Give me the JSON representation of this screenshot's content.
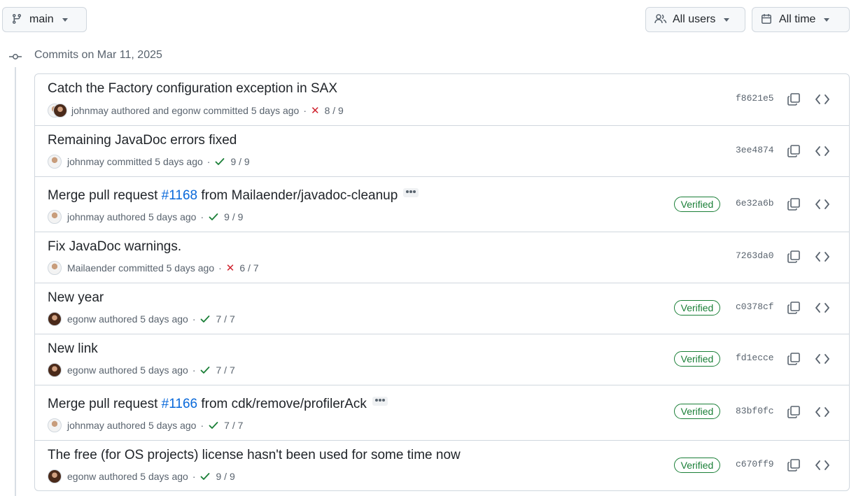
{
  "toolbar": {
    "branch_label": "main",
    "users_label": "All users",
    "time_label": "All time"
  },
  "group": {
    "heading": "Commits on Mar 11, 2025"
  },
  "commits": [
    {
      "title": "Catch the Factory configuration exception in SAX",
      "meta_text": "johnmay authored and egonw committed 5 days ago",
      "status": "fail",
      "checks": "8 / 9",
      "verified": false,
      "sha": "f8621e5"
    },
    {
      "title": "Remaining JavaDoc errors fixed",
      "meta_text": "johnmay committed 5 days ago",
      "status": "success",
      "checks": "9 / 9",
      "verified": false,
      "sha": "3ee4874"
    },
    {
      "title_prefix": "Merge pull request ",
      "pr_link": "#1168",
      "title_suffix": " from Mailaender/javadoc-cleanup",
      "meta_text": "johnmay authored 5 days ago",
      "status": "success",
      "checks": "9 / 9",
      "verified": true,
      "verified_label": "Verified",
      "sha": "6e32a6b"
    },
    {
      "title": "Fix JavaDoc warnings.",
      "meta_text": "Mailaender committed 5 days ago",
      "status": "fail",
      "checks": "6 / 7",
      "verified": false,
      "sha": "7263da0"
    },
    {
      "title": "New year",
      "meta_text": "egonw authored 5 days ago",
      "status": "success",
      "checks": "7 / 7",
      "verified": true,
      "verified_label": "Verified",
      "sha": "c0378cf"
    },
    {
      "title": "New link",
      "meta_text": "egonw authored 5 days ago",
      "status": "success",
      "checks": "7 / 7",
      "verified": true,
      "verified_label": "Verified",
      "sha": "fd1ecce"
    },
    {
      "title_prefix": "Merge pull request ",
      "pr_link": "#1166",
      "title_suffix": " from cdk/remove/profilerAck",
      "meta_text": "johnmay authored 5 days ago",
      "status": "success",
      "checks": "7 / 7",
      "verified": true,
      "verified_label": "Verified",
      "sha": "83bf0fc"
    },
    {
      "title": "The free (for OS projects) license hasn't been used for some time now",
      "meta_text": "egonw authored 5 days ago",
      "status": "success",
      "checks": "9 / 9",
      "verified": true,
      "verified_label": "Verified",
      "sha": "c670ff9"
    }
  ],
  "icons": {
    "branch": "git-branch-icon",
    "users": "people-icon",
    "time": "calendar-icon",
    "commit": "git-commit-icon",
    "copy": "copy-icon",
    "browse": "code-icon",
    "fail": "x-icon",
    "success": "check-icon"
  },
  "colors": {
    "link": "#0969da",
    "success": "#1a7f37",
    "fail": "#cf222e",
    "border": "#d0d7de"
  }
}
